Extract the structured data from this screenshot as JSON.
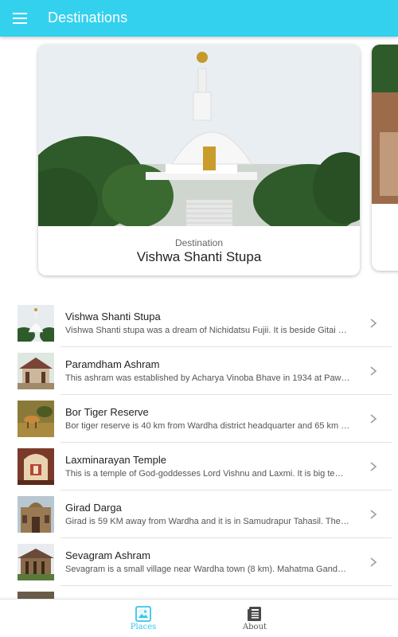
{
  "appbar": {
    "title": "Destinations",
    "menu_icon": "menu-icon"
  },
  "featured": {
    "subtitle": "Destination",
    "title": "Vishwa Shanti Stupa"
  },
  "places": [
    {
      "title": "Vishwa Shanti Stupa",
      "desc": "Vishwa Shanti stupa was a dream of Nichidatsu Fujii. It is beside Gitai …"
    },
    {
      "title": "Paramdham Ashram",
      "desc": "This ashram was established by Acharya Vinoba Bhave in 1934 at Paw…"
    },
    {
      "title": "Bor Tiger Reserve",
      "desc": "Bor tiger reserve is 40 km from Wardha district headquarter and 65 km …"
    },
    {
      "title": "Laxminarayan Temple",
      "desc": "This is a temple of God-goddesses Lord Vishnu and Laxmi. It is big te…"
    },
    {
      "title": "Girad Darga",
      "desc": "Girad is 59 KM away from Wardha and it is in Samudrapur Tahasil. The…"
    },
    {
      "title": "Sevagram Ashram",
      "desc": "Sevagram is a small village near Wardha town (8 km). Mahatma Gand…"
    }
  ],
  "bottom_nav": {
    "places_label": "Places",
    "about_label": "About"
  },
  "colors": {
    "accent": "#33d1ee",
    "active_tab": "#33c6ea"
  }
}
